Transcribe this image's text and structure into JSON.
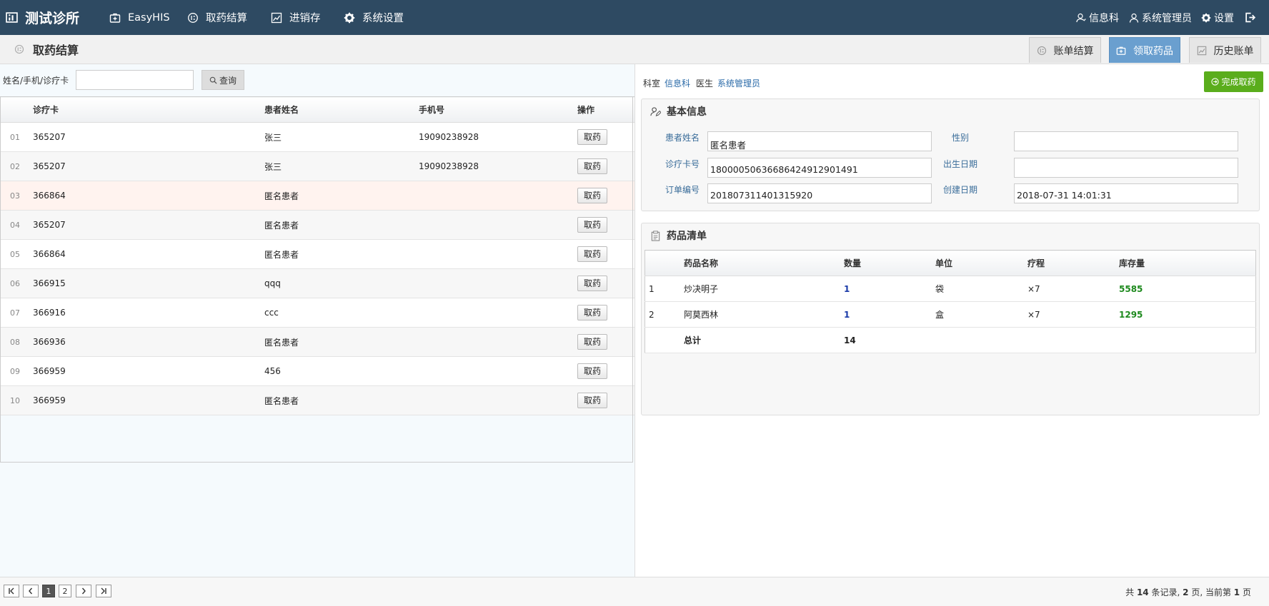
{
  "nav": {
    "brand": "测试诊所",
    "items": [
      "EasyHIS",
      "取药结算",
      "进销存",
      "系统设置"
    ],
    "right": {
      "dept": "信息科",
      "user": "系统管理员",
      "settings": "设置"
    }
  },
  "subheader": {
    "title": "取药结算",
    "tabs": [
      "账单结算",
      "领取药品",
      "历史账单"
    ],
    "active_tab": "领取药品"
  },
  "search": {
    "label": "姓名/手机/诊疗卡",
    "value": "",
    "button": "查询"
  },
  "patients": {
    "columns": [
      "诊疗卡",
      "患者姓名",
      "手机号",
      "操作"
    ],
    "action_label": "取药",
    "rows": [
      {
        "idx": "01",
        "card": "365207",
        "name": "张三",
        "phone": "19090238928"
      },
      {
        "idx": "02",
        "card": "365207",
        "name": "张三",
        "phone": "19090238928"
      },
      {
        "idx": "03",
        "card": "366864",
        "name": "匿名患者",
        "phone": ""
      },
      {
        "idx": "04",
        "card": "365207",
        "name": "匿名患者",
        "phone": ""
      },
      {
        "idx": "05",
        "card": "366864",
        "name": "匿名患者",
        "phone": ""
      },
      {
        "idx": "06",
        "card": "366915",
        "name": "qqq",
        "phone": ""
      },
      {
        "idx": "07",
        "card": "366916",
        "name": "ccc",
        "phone": ""
      },
      {
        "idx": "08",
        "card": "366936",
        "name": "匿名患者",
        "phone": ""
      },
      {
        "idx": "09",
        "card": "366959",
        "name": "456",
        "phone": ""
      },
      {
        "idx": "10",
        "card": "366959",
        "name": "匿名患者",
        "phone": ""
      }
    ]
  },
  "meta": {
    "dept_label": "科室",
    "dept_value": "信息科",
    "doctor_label": "医生",
    "doctor_value": "系统管理员",
    "done_button": "完成取药"
  },
  "basic_info": {
    "title": "基本信息",
    "patient_name_label": "患者姓名",
    "patient_name": "匿名患者",
    "gender_label": "性别",
    "gender": "",
    "card_label": "诊疗卡号",
    "card": "18000050636686424912901491",
    "birth_label": "出生日期",
    "birth": "",
    "order_label": "订单编号",
    "order": "201807311401315920",
    "created_label": "创建日期",
    "created": "2018-07-31 14:01:31"
  },
  "medicines": {
    "title": "药品清单",
    "columns": [
      "药品名称",
      "数量",
      "单位",
      "疗程",
      "库存量"
    ],
    "rows": [
      {
        "idx": "1",
        "name": "炒决明子",
        "qty": "1",
        "unit": "袋",
        "course": "×7",
        "stock": "5585"
      },
      {
        "idx": "2",
        "name": "阿莫西林",
        "qty": "1",
        "unit": "盒",
        "course": "×7",
        "stock": "1295"
      }
    ],
    "total_label": "总计",
    "total": "14"
  },
  "pager": {
    "pages": [
      "1",
      "2"
    ],
    "current": "1",
    "info_pre": "共",
    "records": "14",
    "info_mid": "条记录,",
    "total_pages": "2",
    "info_mid2": "页, 当前第",
    "current_page": "1",
    "info_post": "页"
  },
  "colors": {
    "nav_bg": "#2e4a62",
    "active_tab": "#6a9fcf",
    "done_button": "#5aad1c",
    "link": "#2a6aa8",
    "stock": "#1e8a1e"
  }
}
